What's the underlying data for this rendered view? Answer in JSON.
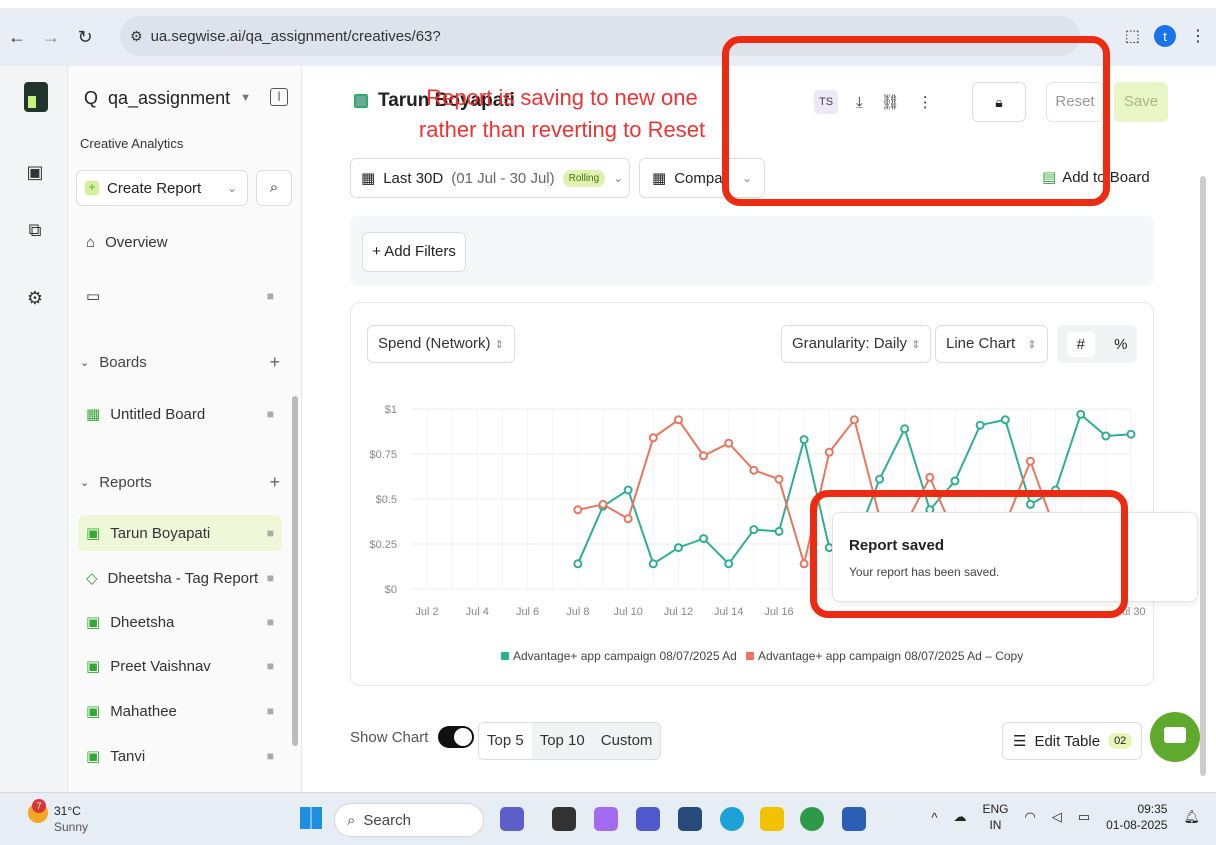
{
  "browser": {
    "url": "ua.segwise.ai/qa_assignment/creatives/63?",
    "profile_initial": "t"
  },
  "sidebar": {
    "workspace": "qa_assignment",
    "section_label": "Creative Analytics",
    "create_report": "Create Report",
    "overview": "Overview",
    "boards_label": "Boards",
    "boards": [
      "Untitled Board"
    ],
    "reports_label": "Reports",
    "reports": [
      "Tarun Boyapati",
      "Dheetsha - Tag Report",
      "Dheetsha",
      "Preet Vaishnav",
      "Mahathee",
      "Tanvi"
    ]
  },
  "header": {
    "report_title": "Tarun Boyapati",
    "ts_initials": "TS",
    "reset": "Reset",
    "save": "Save"
  },
  "annotation": {
    "text": "Report is saving to new one rather than reverting to Reset",
    "color": "#ec2b12"
  },
  "toolbar": {
    "date_range": "Last 30D",
    "date_sub": "(01 Jul - 30 Jul)",
    "rolling": "Rolling",
    "compare": "Compa",
    "add_to_board": "Add to Board",
    "add_filters": "+ Add Filters"
  },
  "chart_controls": {
    "metric": "Spend (Network)",
    "granularity": "Granularity: Daily",
    "chart_type": "Line Chart",
    "mode_hash": "#",
    "mode_pct": "%"
  },
  "chart_data": {
    "type": "line",
    "x": [
      "Jul 2",
      "Jul 3",
      "Jul 4",
      "Jul 5",
      "Jul 6",
      "Jul 7",
      "Jul 8",
      "Jul 9",
      "Jul 10",
      "Jul 11",
      "Jul 12",
      "Jul 13",
      "Jul 14",
      "Jul 15",
      "Jul 16",
      "Jul 17",
      "Jul 18",
      "Jul 19",
      "Jul 20",
      "Jul 21",
      "Jul 22",
      "Jul 23",
      "Jul 24",
      "Jul 25",
      "Jul 26",
      "Jul 27",
      "Jul 28",
      "Jul 29",
      "Jul 30"
    ],
    "x_tick_labels": [
      "Jul 2",
      "Jul 4",
      "Jul 6",
      "Jul 8",
      "Jul 10",
      "Jul 12",
      "Jul 14",
      "Jul 16",
      "Jul 30"
    ],
    "y_ticks": [
      "$1",
      "$0.75",
      "$0.5",
      "$0.25",
      "$0"
    ],
    "ylim": [
      0,
      1
    ],
    "series": [
      {
        "name": "Advantage+ app campaign 08/07/2025 Ad",
        "color": "#2fae96",
        "values": [
          null,
          null,
          null,
          null,
          null,
          null,
          0.14,
          0.46,
          0.55,
          0.14,
          0.23,
          0.28,
          0.14,
          0.33,
          0.32,
          0.83,
          0.23,
          0.25,
          0.61,
          0.89,
          0.44,
          0.6,
          0.91,
          0.94,
          0.47,
          0.55,
          0.97,
          0.85,
          0.86,
          0.57
        ]
      },
      {
        "name": "Advantage+ app campaign 08/07/2025 Ad – Copy",
        "color": "#e8765f",
        "values": [
          null,
          null,
          null,
          null,
          null,
          null,
          0.44,
          0.47,
          0.39,
          0.84,
          0.94,
          0.74,
          0.81,
          0.66,
          0.61,
          0.14,
          0.76,
          0.94,
          0.4,
          0.35,
          0.62,
          0.3,
          0.4,
          0.36,
          0.71,
          0.32,
          0.4,
          0.3,
          0.4,
          0.3
        ]
      }
    ]
  },
  "toast": {
    "title": "Report saved",
    "message": "Your report has been saved."
  },
  "table_controls": {
    "show_chart": "Show Chart",
    "tabs": [
      "Top 5",
      "Top 10",
      "Custom"
    ],
    "edit_table": "Edit Table",
    "edit_count": "02"
  },
  "taskbar": {
    "temp": "31°C",
    "weather": "Sunny",
    "weather_badge": "7",
    "search": "Search",
    "lang_1": "ENG",
    "lang_2": "IN",
    "time": "09:35",
    "date": "01-08-2025"
  }
}
